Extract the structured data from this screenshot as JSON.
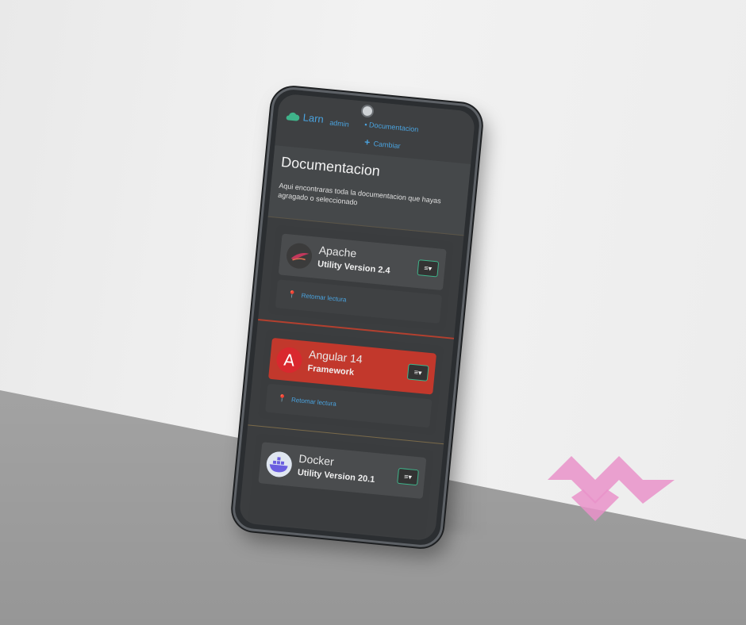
{
  "header": {
    "brand": "Larn",
    "user": "admin",
    "docs_link": "Documentacion",
    "change_link": "Cambiar"
  },
  "page": {
    "title": "Documentacion",
    "description": "Aqui encontraras toda la documentacion que hayas agragado o seleccionado"
  },
  "cards": [
    {
      "name": "Apache",
      "subtitle": "Utility Version 2.4",
      "action": "Retomar lectura",
      "menu_icon": "≡▾",
      "highlighted": false
    },
    {
      "name": "Angular 14",
      "subtitle": "Framework",
      "action": "Retomar lectura",
      "menu_icon": "≡▾",
      "highlighted": true
    },
    {
      "name": "Docker",
      "subtitle": "Utility Version 20.1",
      "action": "",
      "menu_icon": "≡▾",
      "highlighted": false
    }
  ],
  "colors": {
    "accent": "#4aa3df",
    "highlight": "#c2382c",
    "brand_mark": "#e992c9"
  }
}
